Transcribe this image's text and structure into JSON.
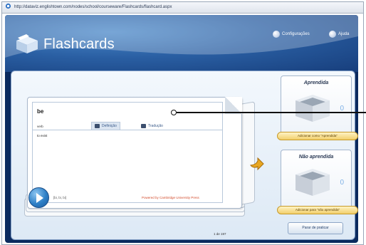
{
  "browser": {
    "url": "http://dataviz.englishtown.com/nodes/school/courseware/Flashcards/flashcard.aspx"
  },
  "app": {
    "title": "Flashcards",
    "header_links": [
      {
        "label": "Configurações",
        "icon": "settings-icon"
      },
      {
        "label": "Ajuda",
        "icon": "help-icon"
      }
    ]
  },
  "card": {
    "word": "be",
    "part_of_speech": "verb",
    "tabs": [
      {
        "label": "Definição",
        "icon": "definition-icon",
        "active": true
      },
      {
        "label": "Tradução",
        "icon": "translation-icon",
        "active": false
      }
    ],
    "definition": "to exist",
    "phonetic": "[bi, bi, bi]",
    "powered_by": "Powered by Cambridge University Press",
    "counter": "1 de 197"
  },
  "panels": {
    "learned": {
      "title": "Aprendida",
      "count": "0",
      "button": "Adicionar como \"Aprendida\""
    },
    "not_learned": {
      "title": "Não aprendida",
      "count": "0",
      "button": "Adicionar para \"não aprendida\""
    }
  },
  "practice_button": "Parar de praticar",
  "colors": {
    "header_blue": "#2a5fa3",
    "app_background": "#0b2a5e",
    "button_gold": "#f2cf6c",
    "count_blue": "#7fb2e6",
    "powered_red": "#d24a2a"
  }
}
